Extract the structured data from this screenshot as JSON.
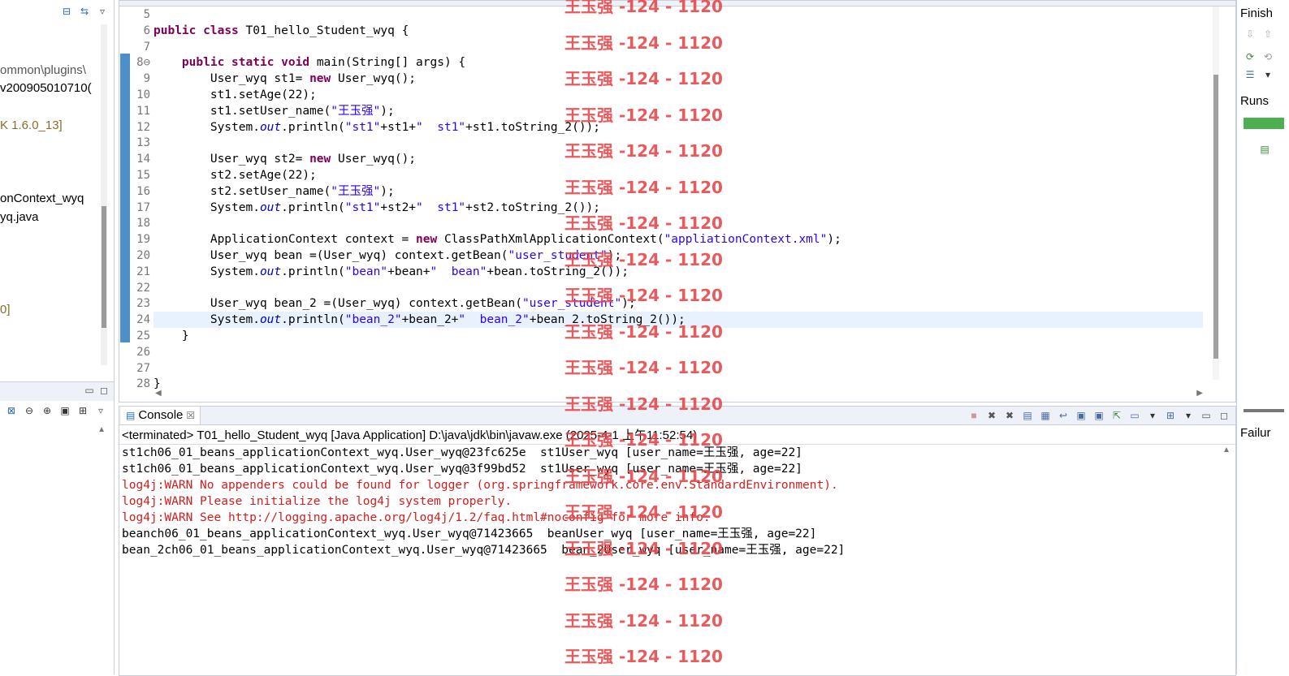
{
  "package_explorer": {
    "rows": [
      "ommon\\plugins\\",
      "v200905010710(",
      "K 1.6.0_13]",
      "onContext_wyq",
      "yq.java",
      "0]"
    ]
  },
  "editor": {
    "lines": [
      {
        "num": "5",
        "tokens": []
      },
      {
        "num": "6",
        "tokens": [
          {
            "t": "kw",
            "v": "public"
          },
          {
            "t": "p",
            "v": " "
          },
          {
            "t": "kw",
            "v": "class"
          },
          {
            "t": "p",
            "v": " T01_hello_Student_wyq {"
          }
        ]
      },
      {
        "num": "7",
        "tokens": []
      },
      {
        "num": "8⊖",
        "tokens": [
          {
            "t": "p",
            "v": "    "
          },
          {
            "t": "kw",
            "v": "public"
          },
          {
            "t": "p",
            "v": " "
          },
          {
            "t": "kw",
            "v": "static"
          },
          {
            "t": "p",
            "v": " "
          },
          {
            "t": "kw",
            "v": "void"
          },
          {
            "t": "p",
            "v": " main(String[] args) {"
          }
        ]
      },
      {
        "num": "9",
        "tokens": [
          {
            "t": "p",
            "v": "        User_wyq st1= "
          },
          {
            "t": "kw",
            "v": "new"
          },
          {
            "t": "p",
            "v": " User_wyq();"
          }
        ]
      },
      {
        "num": "10",
        "tokens": [
          {
            "t": "p",
            "v": "        st1.setAge(22);"
          }
        ]
      },
      {
        "num": "11",
        "tokens": [
          {
            "t": "p",
            "v": "        st1.setUser_name("
          },
          {
            "t": "str",
            "v": "\"王玉强\""
          },
          {
            "t": "p",
            "v": ");"
          }
        ]
      },
      {
        "num": "12",
        "tokens": [
          {
            "t": "p",
            "v": "        System."
          },
          {
            "t": "fld",
            "v": "out"
          },
          {
            "t": "p",
            "v": ".println("
          },
          {
            "t": "str",
            "v": "\"st1\""
          },
          {
            "t": "p",
            "v": "+st1+"
          },
          {
            "t": "str",
            "v": "\"  st1\""
          },
          {
            "t": "p",
            "v": "+st1.toString_2());"
          }
        ]
      },
      {
        "num": "13",
        "tokens": []
      },
      {
        "num": "14",
        "tokens": [
          {
            "t": "p",
            "v": "        User_wyq st2= "
          },
          {
            "t": "kw",
            "v": "new"
          },
          {
            "t": "p",
            "v": " User_wyq();"
          }
        ]
      },
      {
        "num": "15",
        "tokens": [
          {
            "t": "p",
            "v": "        st2.setAge(22);"
          }
        ]
      },
      {
        "num": "16",
        "tokens": [
          {
            "t": "p",
            "v": "        st2.setUser_name("
          },
          {
            "t": "str",
            "v": "\"王玉强\""
          },
          {
            "t": "p",
            "v": ");"
          }
        ]
      },
      {
        "num": "17",
        "tokens": [
          {
            "t": "p",
            "v": "        System."
          },
          {
            "t": "fld",
            "v": "out"
          },
          {
            "t": "p",
            "v": ".println("
          },
          {
            "t": "str",
            "v": "\"st1\""
          },
          {
            "t": "p",
            "v": "+st2+"
          },
          {
            "t": "str",
            "v": "\"  st1\""
          },
          {
            "t": "p",
            "v": "+st2.toString_2());"
          }
        ]
      },
      {
        "num": "18",
        "tokens": []
      },
      {
        "num": "19",
        "tokens": [
          {
            "t": "p",
            "v": "        ApplicationContext context = "
          },
          {
            "t": "kw",
            "v": "new"
          },
          {
            "t": "p",
            "v": " ClassPathXmlApplicationContext("
          },
          {
            "t": "str",
            "v": "\"appliationContext.xml\""
          },
          {
            "t": "p",
            "v": ");"
          }
        ]
      },
      {
        "num": "20",
        "tokens": [
          {
            "t": "p",
            "v": "        User_wyq bean =(User_wyq) context.getBean("
          },
          {
            "t": "str",
            "v": "\"user_student\""
          },
          {
            "t": "p",
            "v": ");"
          }
        ]
      },
      {
        "num": "21",
        "tokens": [
          {
            "t": "p",
            "v": "        System."
          },
          {
            "t": "fld",
            "v": "out"
          },
          {
            "t": "p",
            "v": ".println("
          },
          {
            "t": "str",
            "v": "\"bean\""
          },
          {
            "t": "p",
            "v": "+bean+"
          },
          {
            "t": "str",
            "v": "\"  bean\""
          },
          {
            "t": "p",
            "v": "+bean.toString_2());"
          }
        ]
      },
      {
        "num": "22",
        "tokens": []
      },
      {
        "num": "23",
        "tokens": [
          {
            "t": "p",
            "v": "        User_wyq bean_2 =(User_wyq) context.getBean("
          },
          {
            "t": "str",
            "v": "\"user_student\""
          },
          {
            "t": "p",
            "v": ");"
          }
        ]
      },
      {
        "num": "24",
        "tokens": [
          {
            "t": "p",
            "v": "        System."
          },
          {
            "t": "fld",
            "v": "out"
          },
          {
            "t": "p",
            "v": ".println("
          },
          {
            "t": "str",
            "v": "\"bean_2\""
          },
          {
            "t": "p",
            "v": "+bean_2+"
          },
          {
            "t": "str",
            "v": "\"  bean_2\""
          },
          {
            "t": "p",
            "v": "+bean_2.toString_2());"
          }
        ]
      },
      {
        "num": "25",
        "tokens": [
          {
            "t": "p",
            "v": "    }"
          }
        ]
      },
      {
        "num": "26",
        "tokens": []
      },
      {
        "num": "27",
        "tokens": []
      },
      {
        "num": "28",
        "tokens": [
          {
            "t": "p",
            "v": "}"
          }
        ]
      }
    ],
    "highlighted_line": "24"
  },
  "right_view": {
    "finish_label": "Finish",
    "runs_label": "Runs",
    "failures_label": "Failur"
  },
  "console": {
    "tab_label": "Console",
    "close_glyph": "☒",
    "status": "<terminated> T01_hello_Student_wyq [Java Application] D:\\java\\jdk\\bin\\javaw.exe (2025-4-1 上午11:52:54)",
    "lines": [
      {
        "type": "out",
        "text": "st1ch06_01_beans_applicationContext_wyq.User_wyq@23fc625e  st1User_wyq [user_name=王玉强, age=22]"
      },
      {
        "type": "out",
        "text": "st1ch06_01_beans_applicationContext_wyq.User_wyq@3f99bd52  st1User_wyq [user_name=王玉强, age=22]"
      },
      {
        "type": "err",
        "text": "log4j:WARN No appenders could be found for logger (org.springframework.core.env.StandardEnvironment)."
      },
      {
        "type": "err",
        "text": "log4j:WARN Please initialize the log4j system properly."
      },
      {
        "type": "err",
        "text": "log4j:WARN See http://logging.apache.org/log4j/1.2/faq.html#noconfig for more info."
      },
      {
        "type": "out",
        "text": "beanch06_01_beans_applicationContext_wyq.User_wyq@71423665  beanUser_wyq [user_name=王玉强, age=22]"
      },
      {
        "type": "out",
        "text": "bean_2ch06_01_beans_applicationContext_wyq.User_wyq@71423665  bean_2User_wyq [user_name=王玉强, age=22]"
      }
    ]
  },
  "watermark": {
    "text": "王玉强 -124 - 1120",
    "color": "#e8484a"
  },
  "colors": {
    "keyword": "#7f0055",
    "string": "#2a00ff",
    "field": "#0000c0",
    "error": "#d21e1e",
    "highlight": "#e8f2fe",
    "junit_bar": "#4caf50"
  }
}
